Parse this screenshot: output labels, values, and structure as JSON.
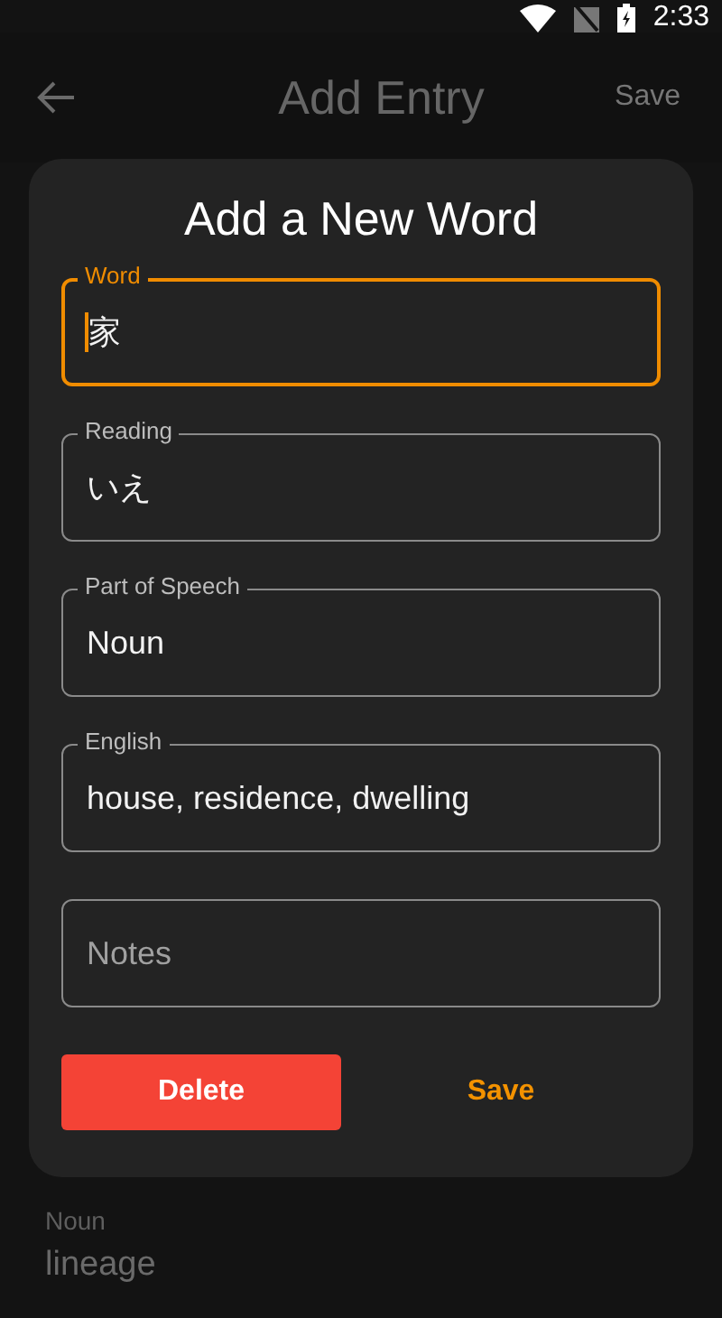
{
  "status_bar": {
    "time": "2:33"
  },
  "app_bar": {
    "title": "Add Entry",
    "action": "Save"
  },
  "background_entry": {
    "part_of_speech": "Noun",
    "meaning": "lineage"
  },
  "dialog": {
    "title": "Add a New Word",
    "fields": [
      {
        "label": "Word",
        "value": "家",
        "focused": true
      },
      {
        "label": "Reading",
        "value": "いえ",
        "focused": false
      },
      {
        "label": "Part of Speech",
        "value": "Noun",
        "focused": false
      },
      {
        "label": "English",
        "value": "house, residence, dwelling",
        "focused": false
      },
      {
        "placeholder": "Notes",
        "focused": false
      }
    ],
    "buttons": [
      {
        "label": "Delete",
        "kind": "filled"
      },
      {
        "label": "Save",
        "kind": "text"
      }
    ]
  }
}
